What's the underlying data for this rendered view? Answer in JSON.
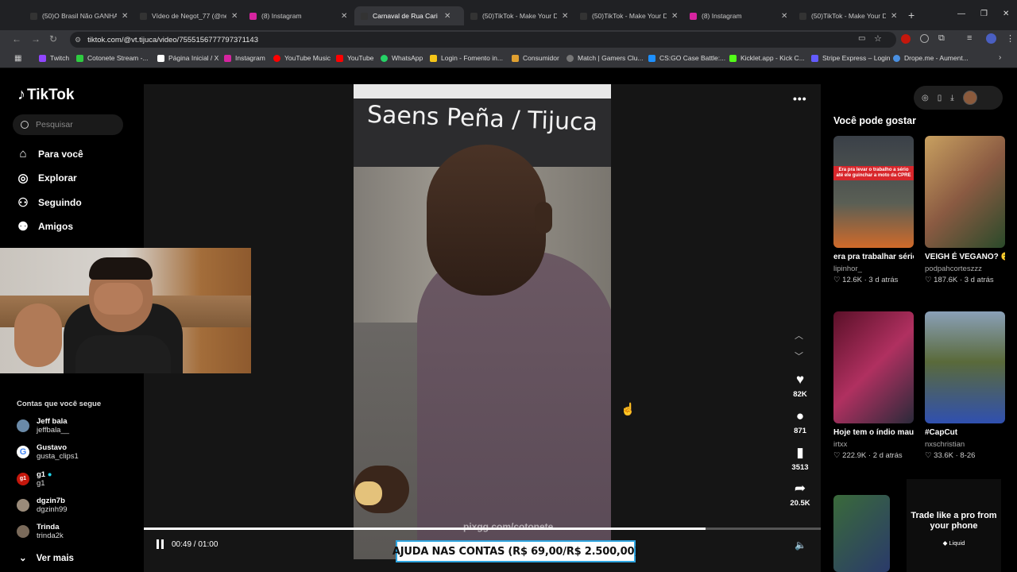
{
  "browser": {
    "tabs": [
      {
        "title": "(50)O Brasil Não GANHAR",
        "color": "#222"
      },
      {
        "title": "Vídeo de Negot_77 (@ne",
        "color": "#111"
      },
      {
        "title": "(8) Instagram",
        "color": "#d6249f"
      },
      {
        "title": "Carnaval de Rua Cari",
        "color": "#111",
        "active": true
      },
      {
        "title": "(50)TikTok - Make Your D",
        "color": "#111"
      },
      {
        "title": "(50)TikTok - Make Your D",
        "color": "#111"
      },
      {
        "title": "(8) Instagram",
        "color": "#d6249f"
      },
      {
        "title": "(50)TikTok - Make Your D",
        "color": "#111"
      }
    ],
    "url": "tiktok.com/@vt.tijuca/video/7555156777797371143",
    "bookmarks": [
      {
        "label": "Twitch",
        "color": "#9146ff"
      },
      {
        "label": "Cotonete Stream -...",
        "color": "#2ecc40"
      },
      {
        "label": "Página Inicial / X",
        "color": "#000"
      },
      {
        "label": "Instagram",
        "color": "#d6249f"
      },
      {
        "label": "YouTube Music",
        "color": "#ff0000"
      },
      {
        "label": "YouTube",
        "color": "#ff0000"
      },
      {
        "label": "WhatsApp",
        "color": "#25d366"
      },
      {
        "label": "Login - Fomento in...",
        "color": "#f5c518"
      },
      {
        "label": "Consumidor",
        "color": "#e0a030"
      },
      {
        "label": "Match | Gamers Clu...",
        "color": "#555"
      },
      {
        "label": "CS:GO Case Battle:...",
        "color": "#1e90ff"
      },
      {
        "label": "Kicklet.app - Kick C...",
        "color": "#53fc18"
      },
      {
        "label": "Stripe Express – Login",
        "color": "#635bff"
      },
      {
        "label": "Drope.me - Aument...",
        "color": "#4a90e2"
      }
    ]
  },
  "sidebar": {
    "logo": "TikTok",
    "search_placeholder": "Pesquisar",
    "nav": [
      {
        "label": "Para você",
        "icon": "home-icon"
      },
      {
        "label": "Explorar",
        "icon": "compass-icon"
      },
      {
        "label": "Seguindo",
        "icon": "following-icon"
      },
      {
        "label": "Amigos",
        "icon": "friends-icon"
      }
    ],
    "section_title": "Contas que você segue",
    "accounts": [
      {
        "name": "Jeff bala",
        "handle": "jeffbala__",
        "color": "#6a8aa8"
      },
      {
        "name": "Gustavo",
        "handle": "gusta_clips1",
        "color": "#ffffff"
      },
      {
        "name": "g1",
        "handle": "g1",
        "color": "#c4170c"
      },
      {
        "name": "dgzin7b",
        "handle": "dgzinh99",
        "color": "#9a8b7a"
      },
      {
        "name": "Trinda",
        "handle": "trinda2k",
        "color": "#7a6a5a"
      }
    ],
    "see_more": "Ver mais"
  },
  "video": {
    "sign_text": "Saens Peña / Tijuca",
    "watermark": "pixgg.com/cotonete",
    "overlay": "AJUDA NAS CONTAS (R$ 69,00/R$ 2.500,00)",
    "time": "00:49 / 01:00",
    "progress": 0.83,
    "likes": "82K",
    "comments": "871",
    "saves": "3513",
    "shares": "20.5K"
  },
  "recommend": {
    "title": "Você pode gostar",
    "cards": [
      {
        "title": "era pra trabalhar sério...",
        "author": "lipinhor_",
        "stats": "♡ 12.6K · 3 d atrás",
        "overlay_text": "Era pra levar o trabalho a sério até ele guinchar a moto da CPRE",
        "c1": "#3a4048",
        "c2": "#e25b1a"
      },
      {
        "title": "VEIGH É VEGANO? 😮 #fy #podpah...",
        "author": "podpahcorteszzz",
        "stats": "♡ 187.6K · 3 d atrás",
        "overlay_text": "",
        "c1": "#8a5a42",
        "c2": "#cc2222"
      },
      {
        "title": "Hoje tem o índio mau 🎤 #alexpoatan...",
        "author": "irtxx",
        "stats": "♡ 222.9K · 2 d atrás",
        "overlay_text": "",
        "c1": "#7a1a3a",
        "c2": "#d04a7a"
      },
      {
        "title": "#CapCut",
        "author": "nxschristian",
        "stats": "♡ 33.6K · 8-26",
        "overlay_text": "",
        "c1": "#5a6a3a",
        "c2": "#3050b0"
      }
    ],
    "ad_line1": "Trade like a pro from your phone",
    "ad_line2": "◆ Liquid"
  }
}
